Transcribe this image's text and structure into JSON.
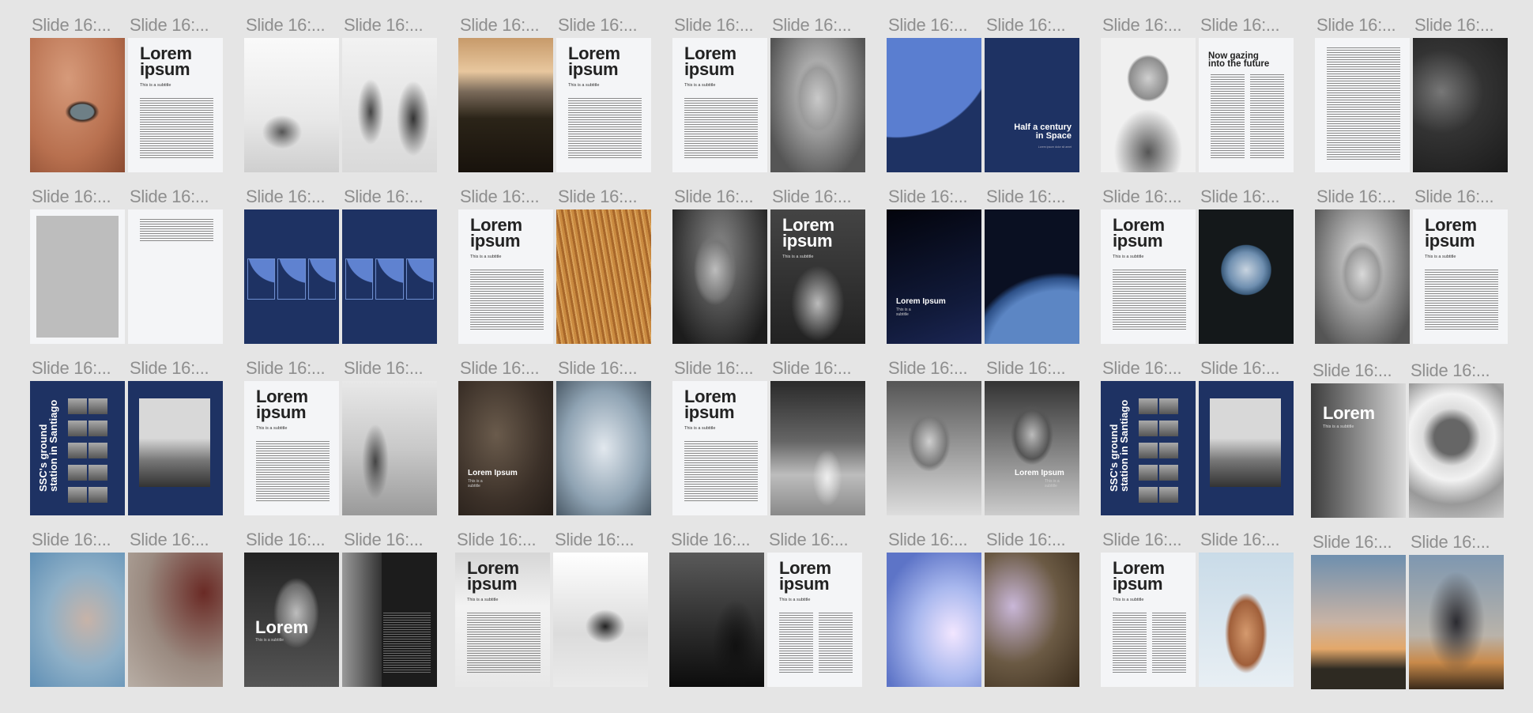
{
  "slide_label": "Slide 16:...",
  "text": {
    "lorem_ipsum": "Lorem\nipsum",
    "subtitle": "This is a subtitle",
    "half_century": "Half a century\nin Space",
    "half_century_caption": "Lorem ipsum dolor sit amet",
    "now_gazing": "Now gazing\ninto the future",
    "lorem_ipsum_single": "Lorem Ipsum",
    "subtitle_short": "This is a\nsubtitle",
    "ssc_title": "SSC's ground\nstation in Santiago",
    "lorem": "Lorem"
  }
}
